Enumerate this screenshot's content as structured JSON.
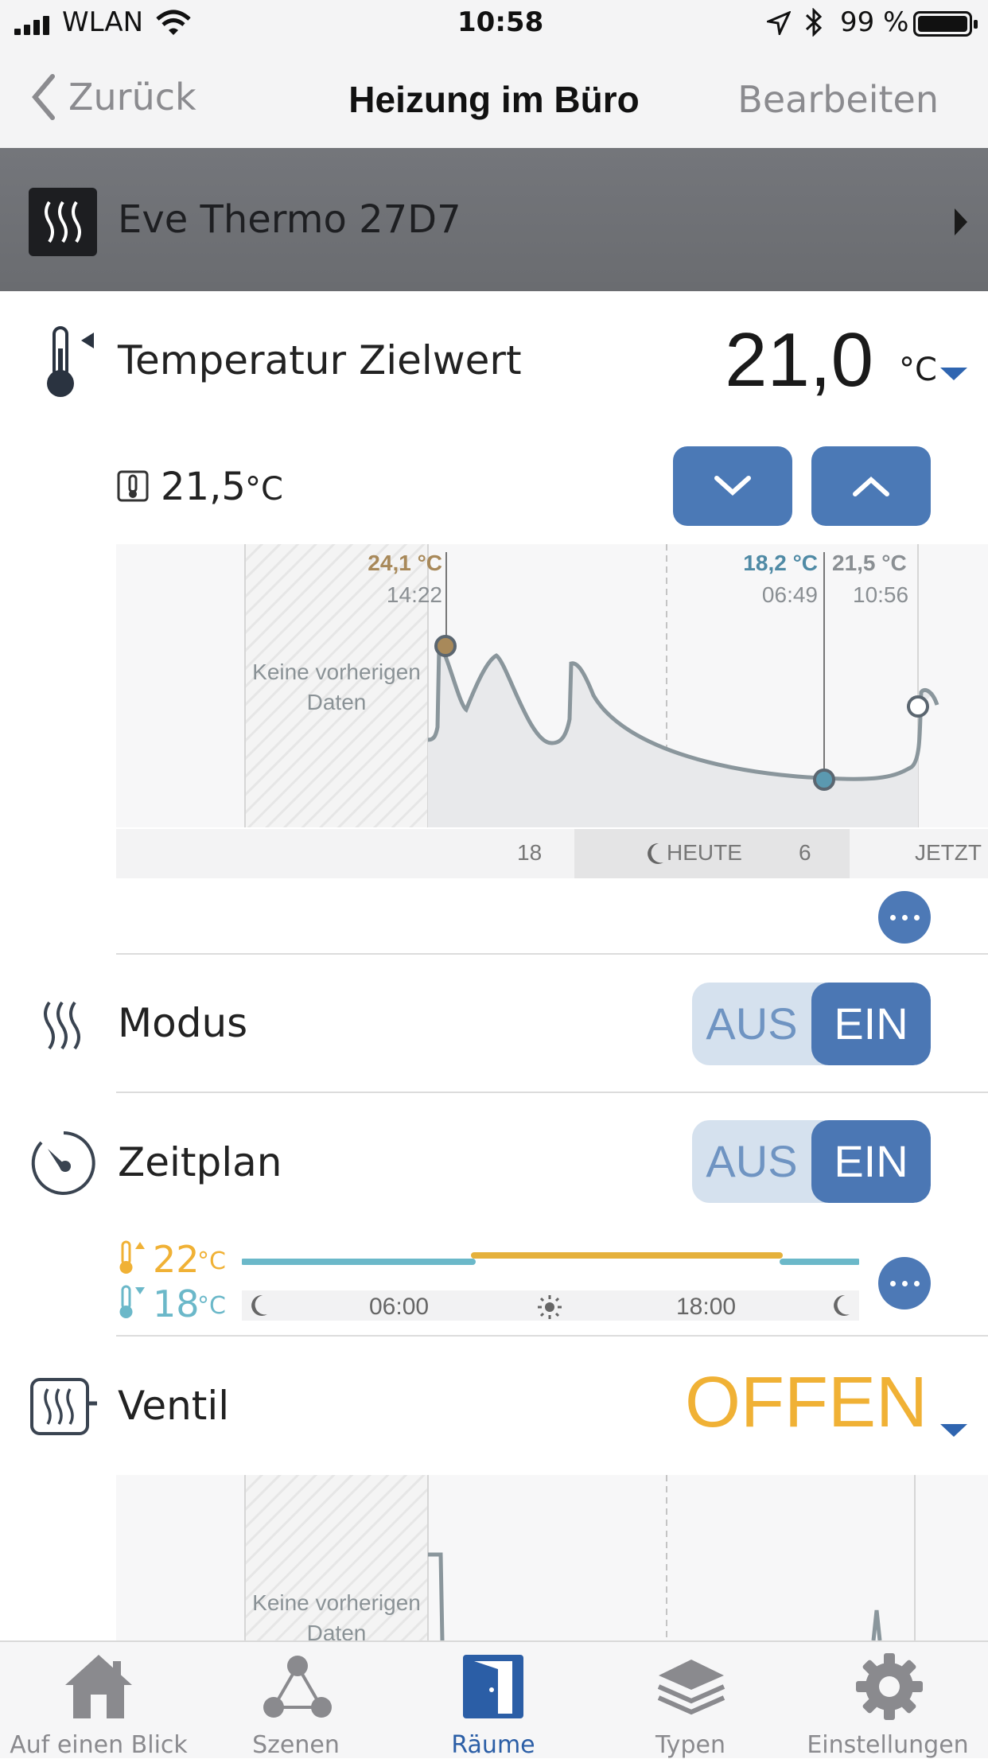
{
  "status_bar": {
    "carrier": "WLAN",
    "time": "10:58",
    "battery": "99 %"
  },
  "nav": {
    "back_label": "Zurück",
    "title": "Heizung im Büro",
    "edit_label": "Bearbeiten"
  },
  "accessory": {
    "name": "Eve Thermo 27D7",
    "icon": "heater-icon"
  },
  "target_temp": {
    "label": "Temperatur Zielwert",
    "value": "21,0",
    "unit": "°C",
    "current_value": "21,5",
    "current_unit": "°C",
    "chart": {
      "no_data_label_1": "Keine vorherigen",
      "no_data_label_2": "Daten",
      "marker_max_value": "24,1 °C",
      "marker_max_time": "14:22",
      "marker_min_value": "18,2 °C",
      "marker_min_time": "06:49",
      "marker_now_value": "21,5 °C",
      "marker_now_time": "10:56",
      "axis_18": "18",
      "axis_today": "HEUTE",
      "axis_6": "6",
      "axis_now": "JETZT"
    }
  },
  "modus": {
    "label": "Modus",
    "off_label": "AUS",
    "on_label": "EIN",
    "state": "EIN"
  },
  "zeitplan": {
    "label": "Zeitplan",
    "off_label": "AUS",
    "on_label": "EIN",
    "state": "EIN",
    "high_temp": "22",
    "low_temp": "18",
    "unit": "°C",
    "time_1": "06:00",
    "time_2": "18:00"
  },
  "ventil": {
    "label": "Ventil",
    "value": "OFFEN",
    "no_data_label_1": "Keine vorherigen",
    "no_data_label_2": "Daten"
  },
  "tabs": [
    {
      "label": "Auf einen Blick",
      "icon": "house-icon"
    },
    {
      "label": "Szenen",
      "icon": "scenes-icon"
    },
    {
      "label": "Räume",
      "icon": "door-icon",
      "active": true
    },
    {
      "label": "Typen",
      "icon": "layers-icon"
    },
    {
      "label": "Einstellungen",
      "icon": "gear-icon"
    }
  ],
  "colors": {
    "accent": "#4b79b6",
    "orange": "#f0b135",
    "teal": "#6bb8c9",
    "gold_marker": "#a8895a"
  }
}
